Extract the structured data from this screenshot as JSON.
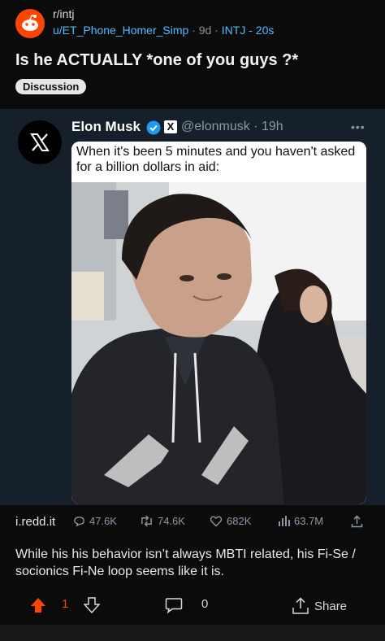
{
  "post": {
    "subreddit": "r/intj",
    "username": "u/ET_Phone_Homer_Simp",
    "age": "9d",
    "flair_meta": "INTJ - 20s",
    "title": "Is he ACTUALLY *one of you guys ?*",
    "flair": "Discussion"
  },
  "tweet": {
    "name": "Elon Musk",
    "x_badge": "X",
    "handle": "@elonmusk",
    "time": "19h",
    "caption": "When it's been 5 minutes and you haven't asked for a billion dollars in aid:"
  },
  "stats": {
    "domain": "i.redd.it",
    "replies": "47.6K",
    "reposts": "74.6K",
    "likes": "682K",
    "views": "63.7M"
  },
  "body_text": "While his his behavior isn’t always MBTI related, his Fi-Se / socionics Fi-Ne loop seems like it is.",
  "actions": {
    "upvotes": "1",
    "comments": "0",
    "share": "Share"
  },
  "colors": {
    "accent": "#4fbcff",
    "reddit": "#ff4500",
    "upvoted": "#ff4500",
    "tweet_bg": "#15202b"
  }
}
